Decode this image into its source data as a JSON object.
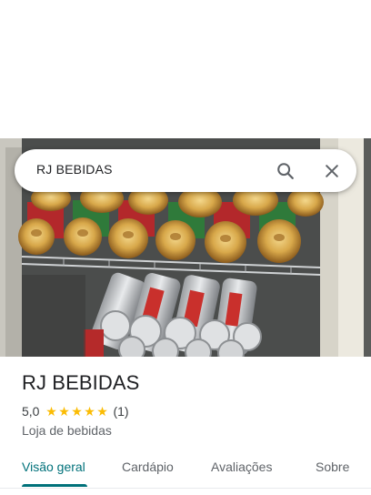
{
  "search": {
    "query": "RJ BEBIDAS"
  },
  "place": {
    "name": "RJ BEBIDAS",
    "rating": "5,0",
    "stars": 5,
    "review_count": "(1)",
    "category": "Loja de bebidas"
  },
  "tabs": [
    {
      "label": "Visão geral",
      "active": true
    },
    {
      "label": "Cardápio",
      "active": false
    },
    {
      "label": "Avaliações",
      "active": false
    },
    {
      "label": "Sobre",
      "active": false
    }
  ],
  "colors": {
    "accent": "#00717a",
    "star": "#fbbc04"
  },
  "icons": {
    "search": "search-icon",
    "close": "close-icon"
  },
  "photo": {
    "subject": "fridge-with-beverage-cans"
  }
}
